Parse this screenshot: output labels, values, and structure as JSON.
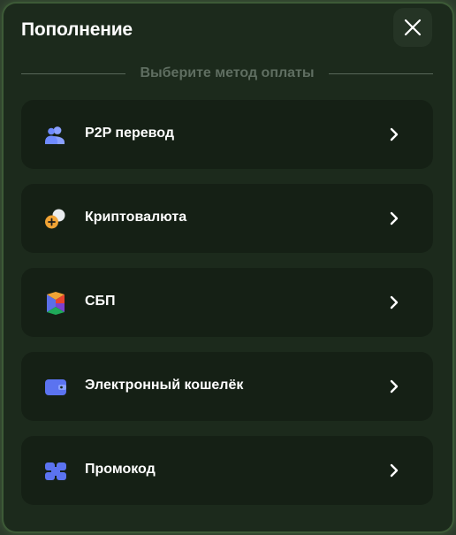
{
  "header": {
    "title": "Пополнение",
    "close_icon": "close-icon"
  },
  "divider": {
    "text": "Выберите метод оплаты"
  },
  "methods": [
    {
      "label": "P2P перевод",
      "icon": "users-icon",
      "icon_color": "#6f8bff"
    },
    {
      "label": "Криптовалюта",
      "icon": "coins-icon",
      "icon_color": "#f0a335"
    },
    {
      "label": "СБП",
      "icon": "sbp-logo-icon",
      "icon_color": "#e8432f"
    },
    {
      "label": "Электронный кошелёк",
      "icon": "wallet-icon",
      "icon_color": "#5b73f0"
    },
    {
      "label": "Промокод",
      "icon": "promo-code-icon",
      "icon_color": "#5b73f0"
    }
  ],
  "colors": {
    "modal_bg": "#1c2a1c",
    "card_bg": "#152015",
    "border_glow": "#3d5a37",
    "text_primary": "#ffffff",
    "text_muted": "#5f6e61"
  }
}
